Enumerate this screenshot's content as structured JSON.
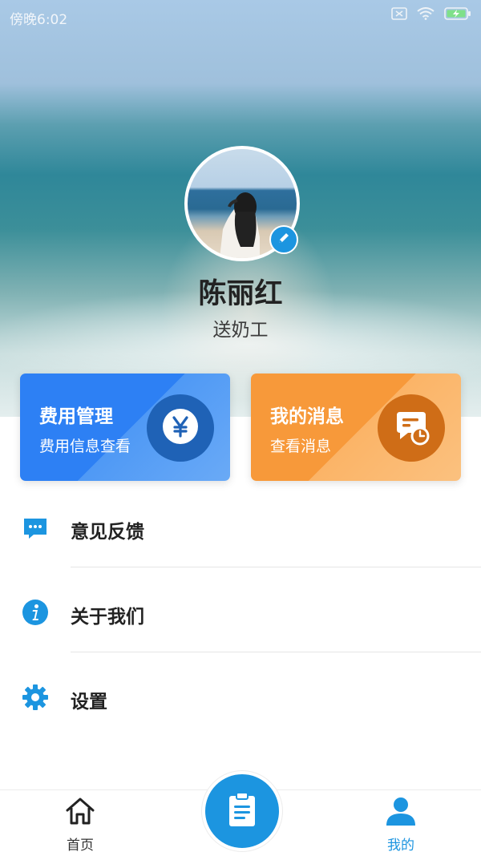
{
  "status_bar": {
    "time": "傍晚6:02"
  },
  "profile": {
    "name": "陈丽红",
    "role": "送奶工"
  },
  "cards": [
    {
      "title": "费用管理",
      "subtitle": "费用信息查看",
      "icon": "yen-icon",
      "color": "#2d80f4"
    },
    {
      "title": "我的消息",
      "subtitle": "查看消息",
      "icon": "message-clock-icon",
      "color": "#f7993a"
    }
  ],
  "menu": [
    {
      "label": "意见反馈",
      "icon": "feedback-chat-icon"
    },
    {
      "label": "关于我们",
      "icon": "info-icon"
    },
    {
      "label": "设置",
      "icon": "gear-icon"
    }
  ],
  "bottom_nav": {
    "home_label": "首页",
    "center_icon": "clipboard-icon",
    "mine_label": "我的",
    "active_color": "#1c95e0"
  },
  "colors": {
    "accent": "#1c95e0"
  }
}
